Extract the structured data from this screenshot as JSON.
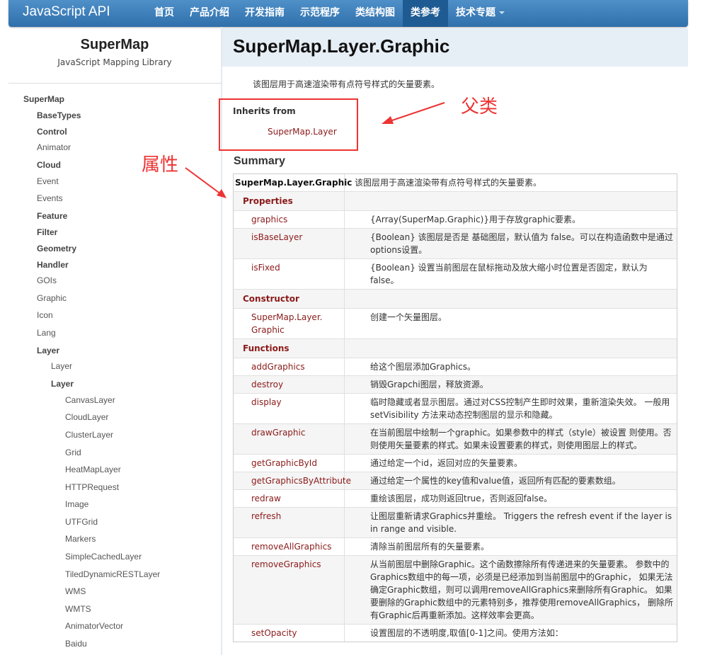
{
  "navbar": {
    "brand": "JavaScript API",
    "items": [
      {
        "label": "首页"
      },
      {
        "label": "产品介绍"
      },
      {
        "label": "开发指南"
      },
      {
        "label": "示范程序"
      },
      {
        "label": "类结构图"
      },
      {
        "label": "类参考",
        "active": true
      },
      {
        "label": "技术专题",
        "dropdown": true
      }
    ]
  },
  "sidebar": {
    "title": "SuperMap",
    "subtitle": "JavaScript Mapping Library",
    "tree": [
      {
        "label": "SuperMap",
        "level": 0,
        "bold": true
      },
      {
        "label": "BaseTypes",
        "level": 1,
        "bold": true
      },
      {
        "label": "Control",
        "level": 1,
        "bold": true
      },
      {
        "label": "Animator",
        "level": 1,
        "bold": false
      },
      {
        "label": "Cloud",
        "level": 1,
        "bold": true
      },
      {
        "label": "Event",
        "level": 1,
        "bold": false
      },
      {
        "label": "Events",
        "level": 1,
        "bold": false
      },
      {
        "label": "Feature",
        "level": 1,
        "bold": true
      },
      {
        "label": "Filter",
        "level": 1,
        "bold": true
      },
      {
        "label": "Geometry",
        "level": 1,
        "bold": true
      },
      {
        "label": "Handler",
        "level": 1,
        "bold": true
      },
      {
        "label": "GOIs",
        "level": 1,
        "bold": false
      },
      {
        "label": "Graphic",
        "level": 1,
        "bold": false
      },
      {
        "label": "Icon",
        "level": 1,
        "bold": false
      },
      {
        "label": "Lang",
        "level": 1,
        "bold": false
      },
      {
        "label": "Layer",
        "level": 1,
        "bold": true
      },
      {
        "label": "Layer",
        "level": 2,
        "bold": false
      },
      {
        "label": "Layer",
        "level": 2,
        "bold": true
      },
      {
        "label": "CanvasLayer",
        "level": 3,
        "bold": false
      },
      {
        "label": "CloudLayer",
        "level": 3,
        "bold": false
      },
      {
        "label": "ClusterLayer",
        "level": 3,
        "bold": false
      },
      {
        "label": "Grid",
        "level": 3,
        "bold": false
      },
      {
        "label": "HeatMapLayer",
        "level": 3,
        "bold": false
      },
      {
        "label": "HTTPRequest",
        "level": 3,
        "bold": false
      },
      {
        "label": "Image",
        "level": 3,
        "bold": false
      },
      {
        "label": "UTFGrid",
        "level": 3,
        "bold": false
      },
      {
        "label": "Markers",
        "level": 3,
        "bold": false
      },
      {
        "label": "SimpleCachedLayer",
        "level": 3,
        "bold": false
      },
      {
        "label": "TiledDynamicRESTLayer",
        "level": 3,
        "bold": false
      },
      {
        "label": "WMS",
        "level": 3,
        "bold": false
      },
      {
        "label": "WMTS",
        "level": 3,
        "bold": false
      },
      {
        "label": "AnimatorVector",
        "level": 3,
        "bold": false
      },
      {
        "label": "Baidu",
        "level": 3,
        "bold": false
      }
    ]
  },
  "content": {
    "title": "SuperMap.Layer.Graphic",
    "description": "该图层用于高速渲染带有点符号样式的矢量要素。",
    "inherits_label": "Inherits from",
    "inherits_link": "SuperMap.Layer",
    "summary_label": "Summary",
    "annotation_parent": "父类",
    "annotation_property": "属性"
  },
  "table": {
    "rows": [
      {
        "kind": "head",
        "name": "SuperMap.Layer.Graphic",
        "desc": "该图层用于高速渲染带有点符号样式的矢量要素。"
      },
      {
        "kind": "section",
        "name": "Properties",
        "desc": ""
      },
      {
        "kind": "item",
        "name": "graphics",
        "desc": "{Array(SuperMap.Graphic)}用于存放graphic要素。"
      },
      {
        "kind": "item",
        "name": "isBaseLayer",
        "desc": "{Boolean} 该图层是否是 基础图层，默认值为 false。可以在构造函数中是通过options设置。"
      },
      {
        "kind": "item",
        "name": "isFixed",
        "desc": "{Boolean} 设置当前图层在鼠标拖动及放大缩小时位置是否固定，默认为 false。"
      },
      {
        "kind": "section",
        "name": "Constructor",
        "desc": ""
      },
      {
        "kind": "item",
        "name": "SuperMap.Layer. Graphic",
        "desc": "创建一个矢量图层。"
      },
      {
        "kind": "section",
        "name": "Functions",
        "desc": ""
      },
      {
        "kind": "item",
        "name": "addGraphics",
        "desc": "给这个图层添加Graphics。"
      },
      {
        "kind": "item",
        "name": "destroy",
        "desc": "销毁Grapchi图层，释放资源。"
      },
      {
        "kind": "item",
        "name": "display",
        "desc": "临时隐藏或者显示图层。通过对CSS控制产生即时效果，重新渲染失效。 一般用setVisibility 方法来动态控制图层的显示和隐藏。"
      },
      {
        "kind": "item",
        "name": "drawGraphic",
        "desc": "在当前图层中绘制一个graphic。如果参数中的样式（style）被设置 则使用。否则使用矢量要素的样式。如果未设置要素的样式，则使用图层上的样式。"
      },
      {
        "kind": "item",
        "name": "getGraphicById",
        "desc": "通过给定一个id，返回对应的矢量要素。"
      },
      {
        "kind": "item",
        "name": "getGraphicsByAttribute",
        "desc": "通过给定一个属性的key值和value值，返回所有匹配的要素数组。"
      },
      {
        "kind": "item",
        "name": "redraw",
        "desc": "重绘该图层，成功则返回true，否则返回false。"
      },
      {
        "kind": "item",
        "name": "refresh",
        "desc": "让图层重新请求Graphics并重绘。 Triggers the refresh event if the layer is in range and visible."
      },
      {
        "kind": "item",
        "name": "removeAllGraphics",
        "desc": "清除当前图层所有的矢量要素。"
      },
      {
        "kind": "item",
        "name": "removeGraphics",
        "desc": "从当前图层中删除Graphic。这个函数擦除所有传递进来的矢量要素。 参数中的Graphics数组中的每一项，必须是已经添加到当前图层中的Graphic， 如果无法确定Graphic数组，则可以调用removeAllGraphics来删除所有Graphic。 如果要删除的Graphic数组中的元素特别多，推荐使用removeAllGraphics， 删除所有Graphic后再重新添加。这样效率会更高。"
      },
      {
        "kind": "item",
        "name": "setOpacity",
        "desc": "设置图层的不透明度,取值[0-1]之间。使用方法如："
      }
    ]
  }
}
